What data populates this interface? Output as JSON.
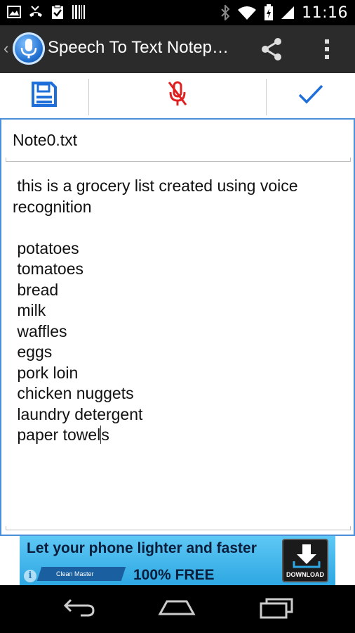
{
  "status_bar": {
    "time": "11:16",
    "icons": [
      "image-icon",
      "missed-call-icon",
      "clipboard-check-icon",
      "barcode-icon",
      "bluetooth-icon",
      "wifi-icon",
      "battery-charging-icon",
      "signal-icon"
    ]
  },
  "action_bar": {
    "title": "Speech To Text Notep…",
    "icons": [
      "app-microphone-icon",
      "share-icon",
      "overflow-menu-icon"
    ]
  },
  "toolbar": {
    "icons": [
      "save-icon",
      "mic-off-icon",
      "checkmark-icon"
    ],
    "colors": {
      "save": "#1e6fd9",
      "mic_off": "#e02020",
      "check": "#1e6fd9"
    }
  },
  "editor": {
    "filename": "Note0.txt",
    "body_text": " this is a grocery list created using voice\nrecognition\n\n potatoes\n tomatoes\n bread\n milk\n waffles\n eggs\n pork loin\n chicken nuggets\n laundry detergent\n paper towel",
    "body_after_cursor": "s",
    "accent": "#4a8fd8"
  },
  "ad": {
    "headline": "Let your phone lighter and faster",
    "subline": "100% FREE",
    "brand": "Clean Master",
    "download_label": "DOWNLOAD",
    "info": "i"
  },
  "nav_bar": {
    "icons": [
      "back-icon",
      "home-icon",
      "recent-apps-icon"
    ]
  }
}
